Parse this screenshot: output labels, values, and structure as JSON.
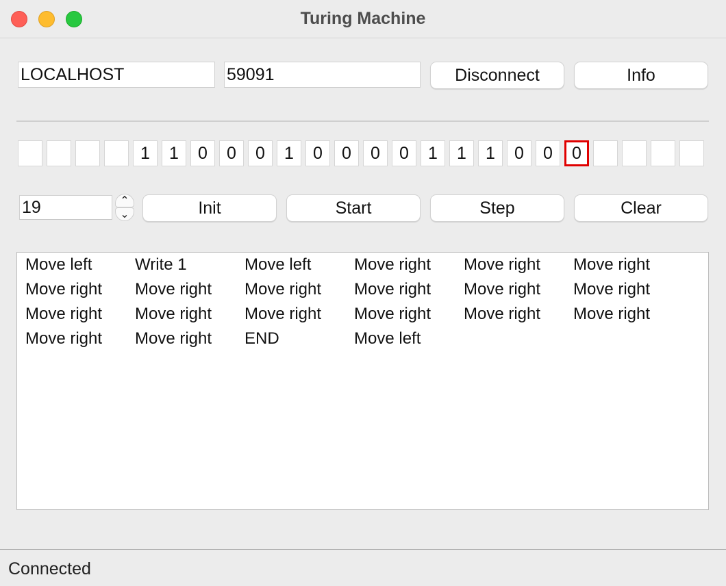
{
  "window": {
    "title": "Turing Machine"
  },
  "connection": {
    "host": "LOCALHOST",
    "port": "59091",
    "disconnect_label": "Disconnect",
    "info_label": "Info"
  },
  "tape": {
    "cells": [
      "",
      "",
      "",
      "",
      "1",
      "1",
      "0",
      "0",
      "0",
      "1",
      "0",
      "0",
      "0",
      "0",
      "1",
      "1",
      "1",
      "0",
      "0",
      "0",
      "",
      "",
      "",
      ""
    ],
    "head_index": 19,
    "head_color": "#e00000"
  },
  "controls": {
    "position_value": "19",
    "init_label": "Init",
    "start_label": "Start",
    "step_label": "Step",
    "clear_label": "Clear"
  },
  "log": {
    "entries": [
      "Move left",
      "Write 1",
      "Move left",
      "Move right",
      "Move right",
      "Move right",
      "Move right",
      "Move right",
      "Move right",
      "Move right",
      "Move right",
      "Move right",
      "Move right",
      "Move right",
      "Move right",
      "Move right",
      "Move right",
      "Move right",
      "Move right",
      "Move right",
      "END",
      "Move left"
    ]
  },
  "status": {
    "text": "Connected"
  }
}
